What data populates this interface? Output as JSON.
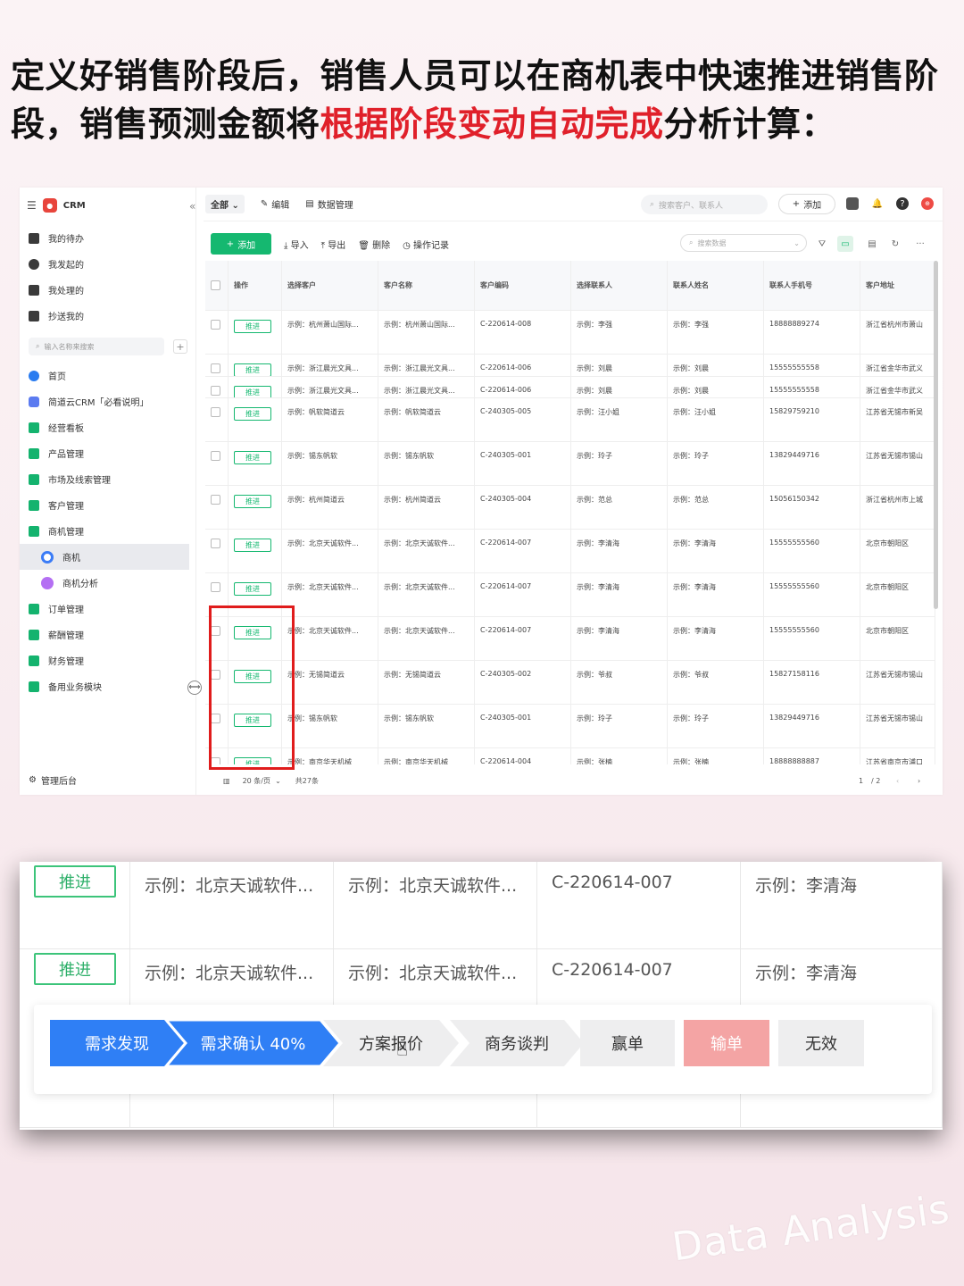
{
  "headline": {
    "line_a": "定义好销售阶段后，销售人员可以在商机表中快速推进销售阶段，销售预测金额将",
    "highlight": "根据阶段变动自动完成",
    "line_b": "分析计算："
  },
  "sidebar": {
    "app_name": "CRM",
    "quick": [
      {
        "label": "我的待办"
      },
      {
        "label": "我发起的"
      },
      {
        "label": "我处理的"
      },
      {
        "label": "抄送我的"
      }
    ],
    "search_placeholder": "输入名称来搜索",
    "nav": [
      {
        "label": "首页",
        "icon": "home-icon"
      },
      {
        "label": "简道云CRM「必看说明」",
        "icon": "doc-icon"
      },
      {
        "label": "经营看板",
        "icon": "folder-icon"
      },
      {
        "label": "产品管理",
        "icon": "folder-icon"
      },
      {
        "label": "市场及线索管理",
        "icon": "folder-icon"
      },
      {
        "label": "客户管理",
        "icon": "folder-icon"
      },
      {
        "label": "商机管理",
        "icon": "folder-icon"
      },
      {
        "label": "商机",
        "icon": "target-icon"
      },
      {
        "label": "商机分析",
        "icon": "chart-icon"
      },
      {
        "label": "订单管理",
        "icon": "folder-icon"
      },
      {
        "label": "薪酬管理",
        "icon": "folder-icon"
      },
      {
        "label": "财务管理",
        "icon": "folder-icon"
      },
      {
        "label": "备用业务模块",
        "icon": "folder-icon"
      }
    ],
    "admin": "管理后台"
  },
  "topbar": {
    "scope": "全部",
    "edit": "编辑",
    "data_mgmt": "数据管理",
    "search_placeholder": "搜索客户、联系人",
    "add": "添加"
  },
  "toolbar": {
    "add": "添加",
    "import": "导入",
    "export": "导出",
    "delete": "删除",
    "log": "操作记录",
    "search_placeholder": "搜索数据"
  },
  "table": {
    "columns": [
      "操作",
      "选择客户",
      "客户名称",
      "客户编码",
      "选择联系人",
      "联系人姓名",
      "联系人手机号",
      "客户地址"
    ],
    "push_label": "推进",
    "rows": [
      [
        "示例：杭州萧山国际...",
        "示例：杭州萧山国际...",
        "C-220614-008",
        "示例：李强",
        "示例：李强",
        "18888889274",
        "浙江省杭州市萧山"
      ],
      [
        "示例：浙江晨光文具...",
        "示例：浙江晨光文具...",
        "C-220614-006",
        "示例：刘晨",
        "示例：刘晨",
        "15555555558",
        "浙江省金华市武义"
      ],
      [
        "示例：浙江晨光文具...",
        "示例：浙江晨光文具...",
        "C-220614-006",
        "示例：刘晨",
        "示例：刘晨",
        "15555555558",
        "浙江省金华市武义"
      ],
      [
        "示例：帆软简道云",
        "示例：帆软简道云",
        "C-240305-005",
        "示例：汪小姐",
        "示例：汪小姐",
        "15829759210",
        "江苏省无锡市新吴"
      ],
      [
        "示例：锡东帆软",
        "示例：锡东帆软",
        "C-240305-001",
        "示例：玲子",
        "示例：玲子",
        "13829449716",
        "江苏省无锡市锡山"
      ],
      [
        "示例：杭州简道云",
        "示例：杭州简道云",
        "C-240305-004",
        "示例：范总",
        "示例：范总",
        "15056150342",
        "浙江省杭州市上城"
      ],
      [
        "示例：北京天诚软件...",
        "示例：北京天诚软件...",
        "C-220614-007",
        "示例：李清海",
        "示例：李清海",
        "15555555560",
        "北京市朝阳区"
      ],
      [
        "示例：北京天诚软件...",
        "示例：北京天诚软件...",
        "C-220614-007",
        "示例：李清海",
        "示例：李清海",
        "15555555560",
        "北京市朝阳区"
      ],
      [
        "示例：北京天诚软件...",
        "示例：北京天诚软件...",
        "C-220614-007",
        "示例：李清海",
        "示例：李清海",
        "15555555560",
        "北京市朝阳区"
      ],
      [
        "示例：无锡简道云",
        "示例：无锡简道云",
        "C-240305-002",
        "示例：爷叔",
        "示例：爷叔",
        "15827158116",
        "江苏省无锡市锡山"
      ],
      [
        "示例：锡东帆软",
        "示例：锡东帆软",
        "C-240305-001",
        "示例：玲子",
        "示例：玲子",
        "13829449716",
        "江苏省无锡市锡山"
      ],
      [
        "示例：南京华天机械",
        "示例：南京华天机械",
        "C-220614-004",
        "示例：张楠",
        "示例：张楠",
        "18888888887",
        "江苏省南京市浦口"
      ]
    ]
  },
  "pager": {
    "page_size": "20 条/页",
    "total": "共27条",
    "current": "1",
    "pages": "/ 2"
  },
  "zoom": {
    "push_label": "推进",
    "row": [
      "示例：北京天诚软件...",
      "示例：北京天诚软件...",
      "C-220614-007",
      "示例：李清海"
    ],
    "stages": [
      {
        "label": "需求发现",
        "state": "done"
      },
      {
        "label": "需求确认 40%",
        "state": "current"
      },
      {
        "label": "方案报价",
        "state": "todo"
      },
      {
        "label": "商务谈判",
        "state": "todo"
      },
      {
        "label": "赢单",
        "state": "todo"
      },
      {
        "label": "输单",
        "state": "lost"
      },
      {
        "label": "无效",
        "state": "invalid"
      }
    ],
    "colors": {
      "done": "#2f7ff5",
      "lost": "#f4a4a4",
      "green": "#15b870"
    }
  },
  "watermark": "Data Analysis"
}
